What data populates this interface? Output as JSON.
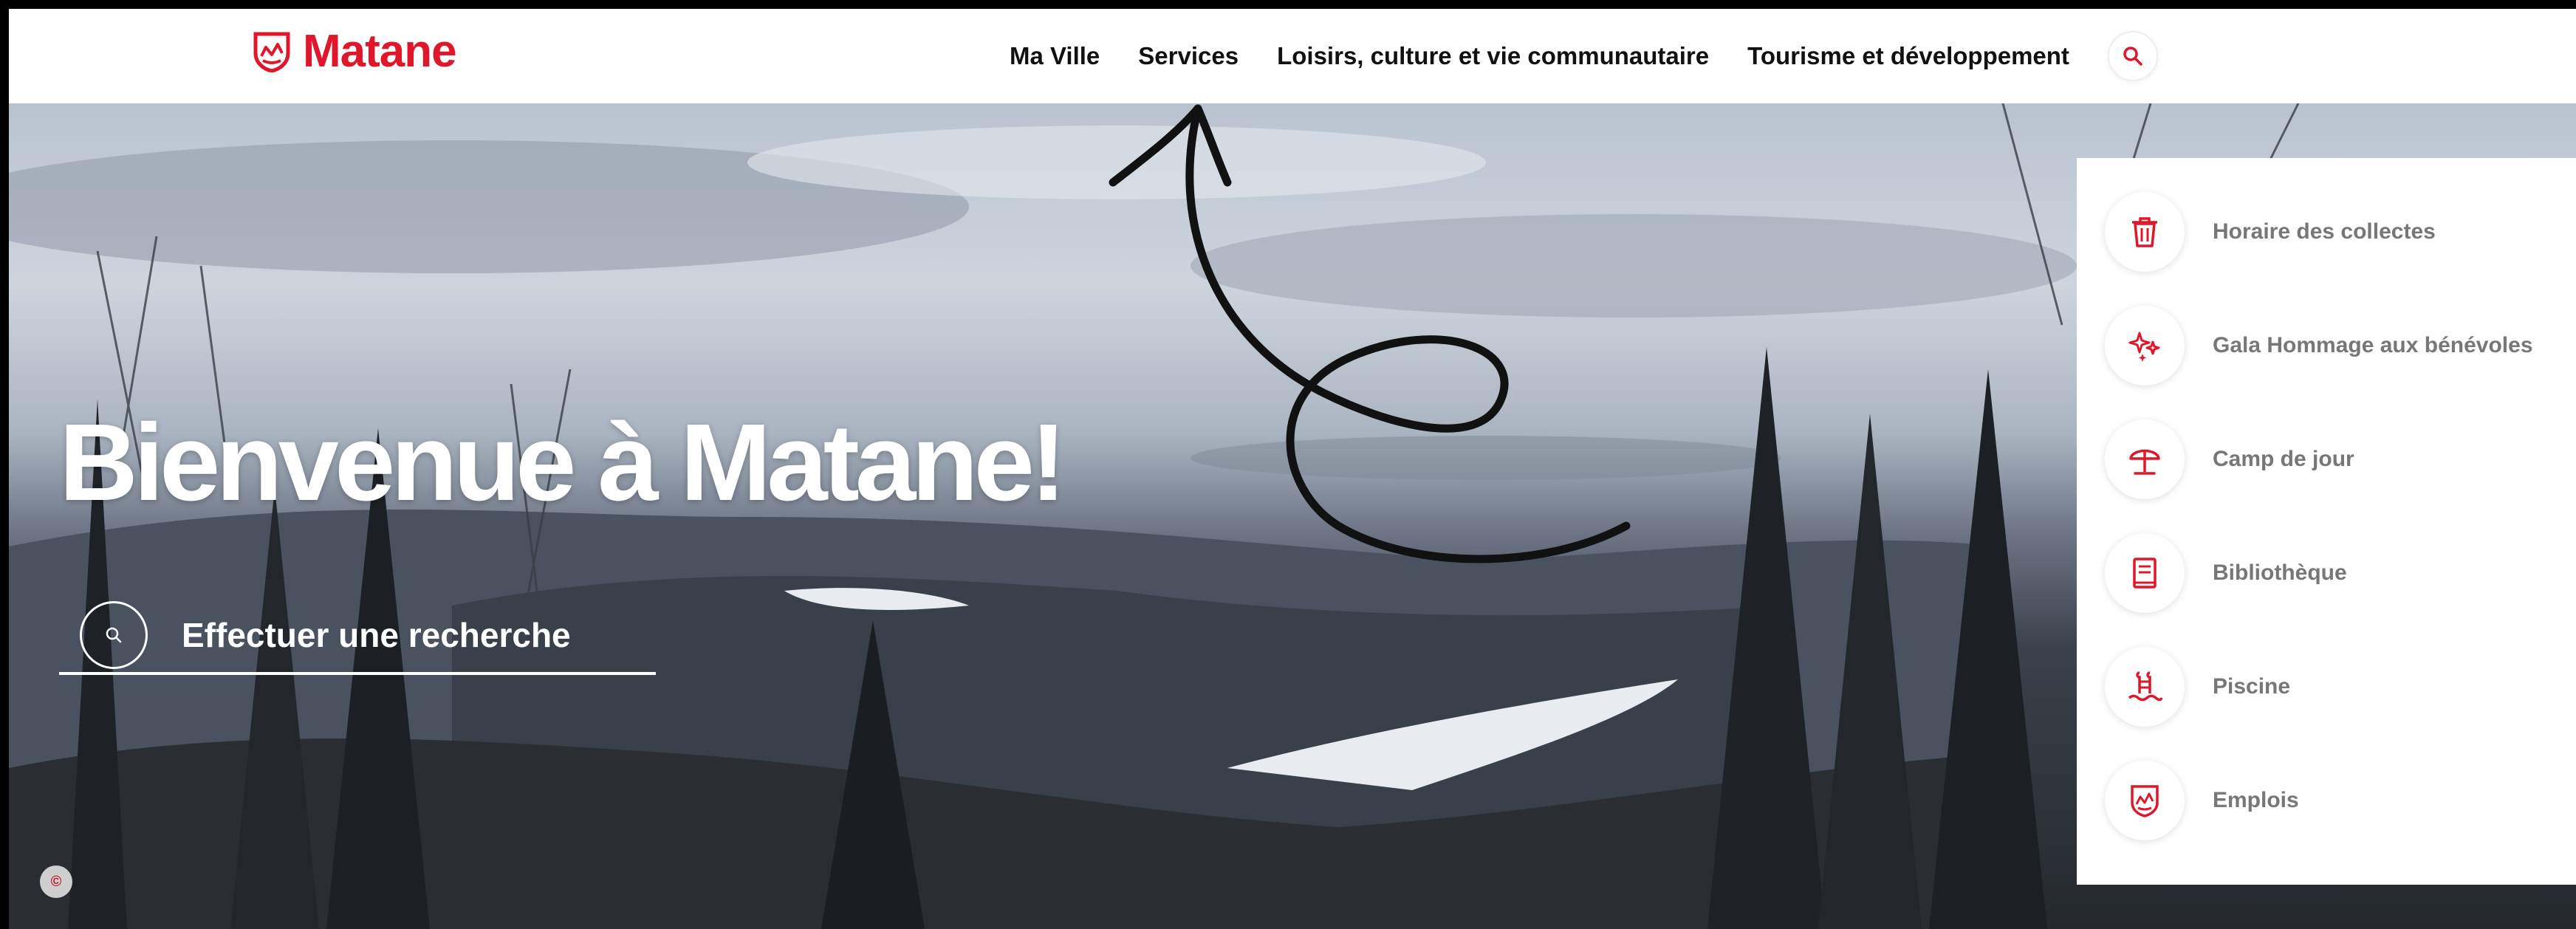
{
  "brand": {
    "name": "Matane",
    "color": "#e0162b"
  },
  "nav": {
    "items": [
      {
        "label": "Ma Ville"
      },
      {
        "label": "Services"
      },
      {
        "label": "Loisirs, culture et vie communautaire"
      },
      {
        "label": "Tourisme et développement"
      }
    ],
    "search_icon": "search-icon"
  },
  "hero": {
    "title": "Bienvenue à Matane!",
    "search_label": "Effectuer une recherche",
    "search_icon": "search-icon"
  },
  "quick_links": [
    {
      "label": "Horaire des collectes",
      "icon": "trash-icon"
    },
    {
      "label": "Gala Hommage aux bénévoles",
      "icon": "sparkles-icon"
    },
    {
      "label": "Camp de jour",
      "icon": "umbrella-icon"
    },
    {
      "label": "Bibliothèque",
      "icon": "book-icon"
    },
    {
      "label": "Piscine",
      "icon": "pool-ladder-icon"
    },
    {
      "label": "Emplois",
      "icon": "matane-crest-icon"
    }
  ],
  "privacy_badge_icon": "cookie-settings-icon"
}
